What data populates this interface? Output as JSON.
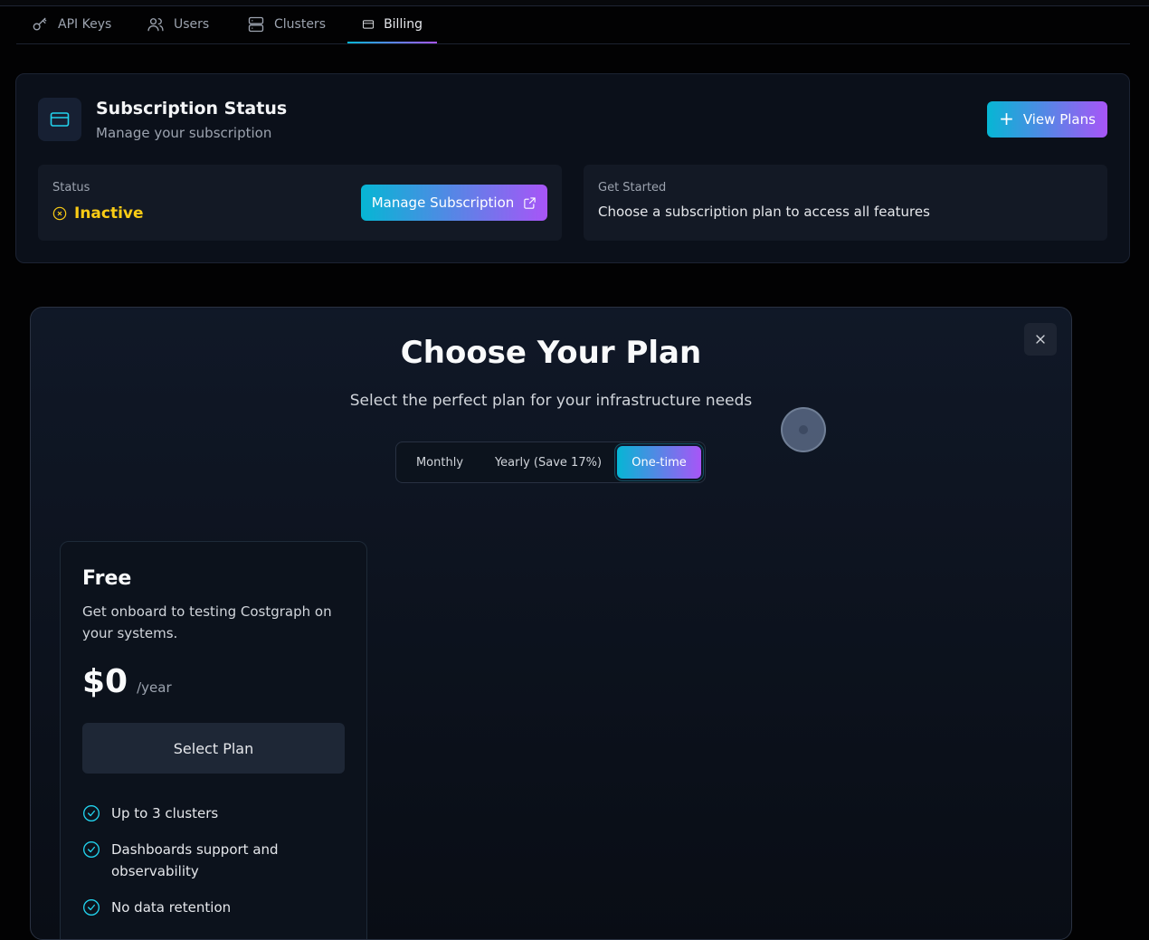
{
  "tabs": [
    {
      "label": "API Keys",
      "icon": "key-icon"
    },
    {
      "label": "Users",
      "icon": "users-icon"
    },
    {
      "label": "Clusters",
      "icon": "server-icon"
    },
    {
      "label": "Billing",
      "icon": "credit-card-icon",
      "active": true
    }
  ],
  "subscription": {
    "title": "Subscription Status",
    "subtitle": "Manage your subscription",
    "view_plans_label": "View Plans",
    "status_label": "Status",
    "status_value": "Inactive",
    "manage_label": "Manage Subscription",
    "get_started_label": "Get Started",
    "get_started_text": "Choose a subscription plan to access all features"
  },
  "modal": {
    "title": "Choose Your Plan",
    "subtitle": "Select the perfect plan for your infrastructure needs",
    "billing_options": [
      "Monthly",
      "Yearly (Save 17%)",
      "One-time"
    ],
    "selected_option": "One-time"
  },
  "plan": {
    "name": "Free",
    "description": "Get onboard to testing Costgraph on your systems.",
    "price": "$0",
    "period": "/year",
    "button_label": "Select Plan",
    "features": [
      "Up to 3 clusters",
      "Dashboards support and observability",
      "No data retention"
    ]
  },
  "colors": {
    "accent_start": "#06b6d4",
    "accent_end": "#a855f7",
    "status_inactive": "#facc15"
  }
}
